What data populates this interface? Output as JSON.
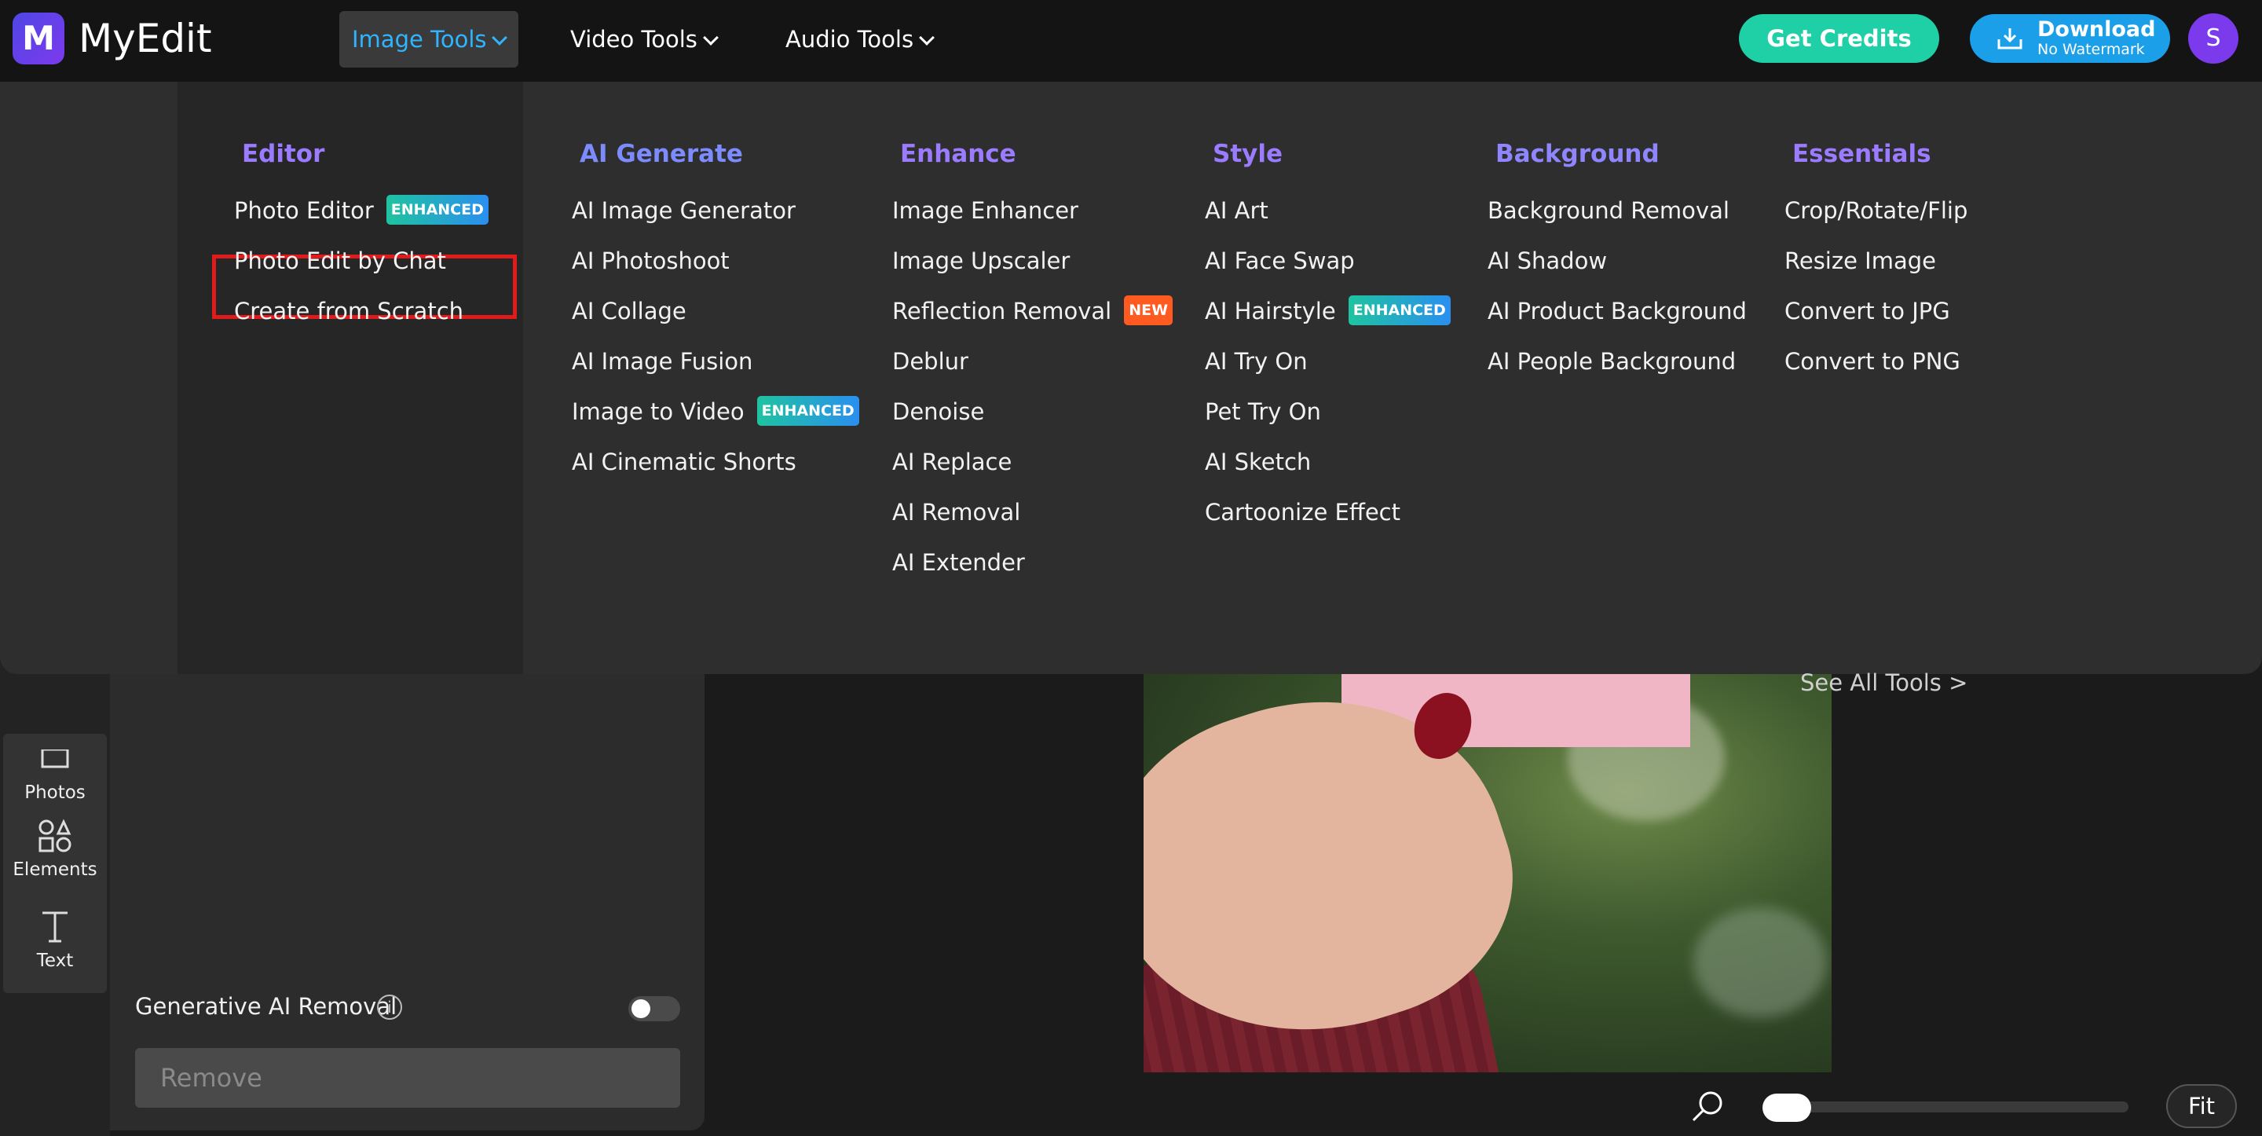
{
  "app": {
    "brand": "MyEdit",
    "logo_letter": "M"
  },
  "nav": {
    "image_tools": "Image Tools",
    "video_tools": "Video Tools",
    "audio_tools": "Audio Tools",
    "get_credits": "Get Credits",
    "download": "Download",
    "download_sub": "No Watermark",
    "avatar_letter": "S"
  },
  "menu": {
    "columns": [
      {
        "title": "Editor",
        "color": "#9b7bff",
        "items": [
          {
            "label": "Photo Editor",
            "badge": "ENHANCED"
          },
          {
            "label": "Photo Edit by Chat"
          },
          {
            "label": "Create from Scratch"
          }
        ]
      },
      {
        "title": "AI Generate",
        "color": "#7c8cff",
        "items": [
          {
            "label": "AI Image Generator"
          },
          {
            "label": "AI Photoshoot"
          },
          {
            "label": "AI Collage"
          },
          {
            "label": "AI Image Fusion"
          },
          {
            "label": "Image to Video",
            "badge": "ENHANCED"
          },
          {
            "label": "AI Cinematic Shorts"
          }
        ]
      },
      {
        "title": "Enhance",
        "color": "#9b7bff",
        "items": [
          {
            "label": "Image Enhancer"
          },
          {
            "label": "Image Upscaler"
          },
          {
            "label": "Reflection Removal",
            "badge": "NEW"
          },
          {
            "label": "Deblur"
          },
          {
            "label": "Denoise"
          },
          {
            "label": "AI Replace"
          },
          {
            "label": "AI Removal"
          },
          {
            "label": "AI Extender"
          }
        ]
      },
      {
        "title": "Style",
        "color": "#9b7bff",
        "items": [
          {
            "label": "AI Art"
          },
          {
            "label": "AI Face Swap"
          },
          {
            "label": "AI Hairstyle",
            "badge": "ENHANCED"
          },
          {
            "label": "AI Try On"
          },
          {
            "label": "Pet Try On"
          },
          {
            "label": "AI Sketch"
          },
          {
            "label": "Cartoonize Effect"
          }
        ]
      },
      {
        "title": "Background",
        "color": "#8f86ff",
        "items": [
          {
            "label": "Background Removal"
          },
          {
            "label": "AI Shadow"
          },
          {
            "label": "AI Product Background"
          },
          {
            "label": "AI People Background"
          }
        ]
      },
      {
        "title": "Essentials",
        "color": "#9b7bff",
        "items": [
          {
            "label": "Crop/Rotate/Flip"
          },
          {
            "label": "Resize Image"
          },
          {
            "label": "Convert to JPG"
          },
          {
            "label": "Convert to PNG"
          }
        ]
      }
    ],
    "see_all": "See All Tools >"
  },
  "rail": {
    "photos": "Photos",
    "elements": "Elements",
    "text": "Text"
  },
  "panel": {
    "generative_label": "Generative AI Removal",
    "info": "i",
    "remove": "Remove"
  },
  "canvas": {
    "fit": "Fit"
  },
  "colors": {
    "accent": "#2fb5ff",
    "credits": "#1fcfa5",
    "download": "#1a9fe8",
    "highlight": "#e01b1b"
  }
}
